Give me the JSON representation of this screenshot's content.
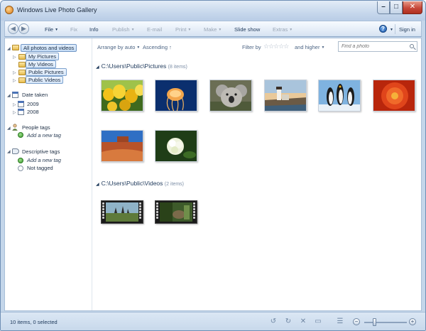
{
  "window": {
    "title": "Windows Live Photo Gallery",
    "controls": {
      "minimize": "–",
      "maximize": "□",
      "close": "✕"
    }
  },
  "toolbar": {
    "back": "◀",
    "forward": "▶",
    "menus": [
      {
        "label": "File",
        "caret": "▼",
        "enabled": true
      },
      {
        "label": "Fix",
        "enabled": false
      },
      {
        "label": "Info",
        "enabled": true
      },
      {
        "label": "Publish",
        "caret": "▼",
        "enabled": false
      },
      {
        "label": "E-mail",
        "enabled": false
      },
      {
        "label": "Print",
        "caret": "▼",
        "enabled": false
      },
      {
        "label": "Make",
        "caret": "▼",
        "enabled": false
      },
      {
        "label": "Slide show",
        "enabled": true
      },
      {
        "label": "Extras",
        "caret": "▼",
        "enabled": false
      }
    ],
    "help": "?",
    "sign_in": "Sign in"
  },
  "navigation": {
    "all_items": "All photos and videos",
    "libraries": [
      {
        "label": "My Pictures"
      },
      {
        "label": "My Videos"
      },
      {
        "label": "Public Pictures"
      },
      {
        "label": "Public Videos"
      }
    ],
    "date_taken": {
      "label": "Date taken",
      "years": [
        "2009",
        "2008"
      ]
    },
    "people_tags": {
      "label": "People tags",
      "add": "Add a new tag"
    },
    "descriptive_tags": {
      "label": "Descriptive tags",
      "add": "Add a new tag",
      "not_tagged": "Not tagged"
    }
  },
  "filterbar": {
    "arrange": "Arrange by auto",
    "sort": "Ascending",
    "sort_icon": "↑",
    "filter_by": "Filter by",
    "stars": "☆☆☆☆☆",
    "and_higher": "and higher",
    "search_placeholder": "Find a photo"
  },
  "groups": {
    "pictures": {
      "title": "C:\\Users\\Public\\Pictures",
      "count": "(8 items)",
      "items": [
        "tulips",
        "jellyfish",
        "koala",
        "lighthouse",
        "penguins",
        "chrysanthemum",
        "desert",
        "hydrangeas"
      ]
    },
    "videos": {
      "title": "C:\\Users\\Public\\Videos",
      "count": "(2 items)",
      "items": [
        "wildlife-video-1",
        "wildlife-video-2"
      ]
    }
  },
  "status": {
    "text": "10 items, 0 selected",
    "zoom_out": "−",
    "zoom_in": "+",
    "zoom_level": 0.2
  },
  "colors": {
    "frame": "#c4d6ea",
    "accent": "#1e395b",
    "close_button": "#c6483a"
  }
}
